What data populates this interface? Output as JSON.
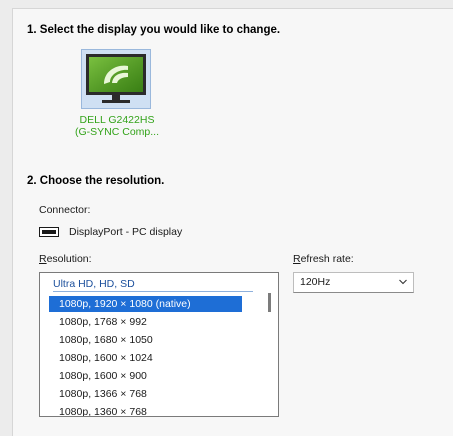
{
  "section1": {
    "title": "1. Select the display you would like to change."
  },
  "display": {
    "name_line1": "DELL G2422HS",
    "name_line2": "(G-SYNC Comp...",
    "caption_color": "#33a31a",
    "icon": "nvidia-monitor-icon"
  },
  "section2": {
    "title": "2. Choose the resolution."
  },
  "connector": {
    "label": "Connector:",
    "value": "DisplayPort - PC display",
    "icon": "displayport-icon"
  },
  "resolution": {
    "label": "Resolution:",
    "group_header": "Ultra HD, HD, SD",
    "items": [
      "1080p, 1920 × 1080 (native)",
      "1080p, 1768 × 992",
      "1080p, 1680 × 1050",
      "1080p, 1600 × 1024",
      "1080p, 1600 × 900",
      "1080p, 1366 × 768",
      "1080p, 1360 × 768"
    ],
    "selected_index": 0,
    "selection_color": "#1e6ed6"
  },
  "refresh_rate": {
    "label": "Refresh rate:",
    "value": "120Hz",
    "icon": "chevron-down-icon"
  }
}
